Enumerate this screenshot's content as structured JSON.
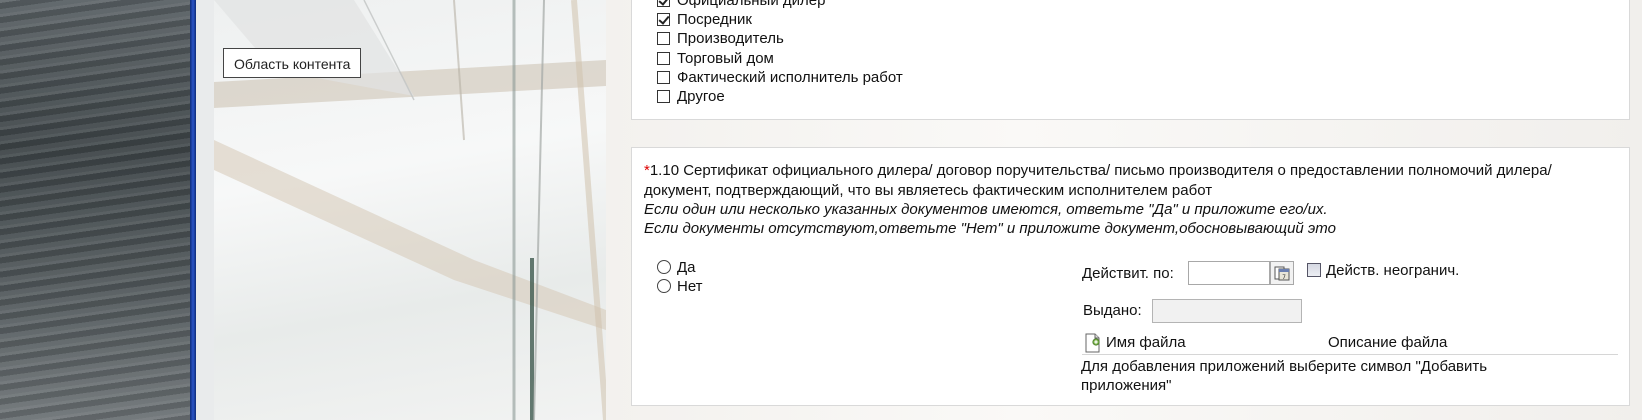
{
  "tooltip": {
    "text": "Область контента"
  },
  "checkbox_list": {
    "items": [
      {
        "label": "Официальный дилер",
        "checked": true
      },
      {
        "label": "Посредник",
        "checked": true
      },
      {
        "label": "Производитель",
        "checked": false
      },
      {
        "label": "Торговый дом",
        "checked": false
      },
      {
        "label": "Фактический исполнитель работ",
        "checked": false
      },
      {
        "label": "Другое",
        "checked": false
      }
    ]
  },
  "question": {
    "required_mark": "*",
    "text": "1.10 Сертификат официального дилера/ договор поручительства/ письмо производителя о предоставлении полномочий дилера/ документ, подтверждающий, что вы являетесь фактическим исполнителем работ",
    "hint_yes": "Если один или несколько указанных документов имеются, ответьте \"Да\" и приложите его/их.",
    "hint_no": "Если документы отсутствуют,ответьте \"Нет\" и приложите документ,обосновывающий это",
    "options": [
      "Да",
      "Нет"
    ]
  },
  "fields": {
    "valid_until_label": "Действит. по:",
    "valid_until_value": "",
    "unlimited_label": "Действ. неогранич.",
    "issued_label": "Выдано:",
    "issued_value": ""
  },
  "files": {
    "name_header": "Имя файла",
    "description_header": "Описание файла",
    "hint": "Для добавления приложений выберите символ \"Добавить приложения\""
  },
  "colors": {
    "divider_blue": "#1f45b0",
    "required_red": "#dd0000"
  }
}
